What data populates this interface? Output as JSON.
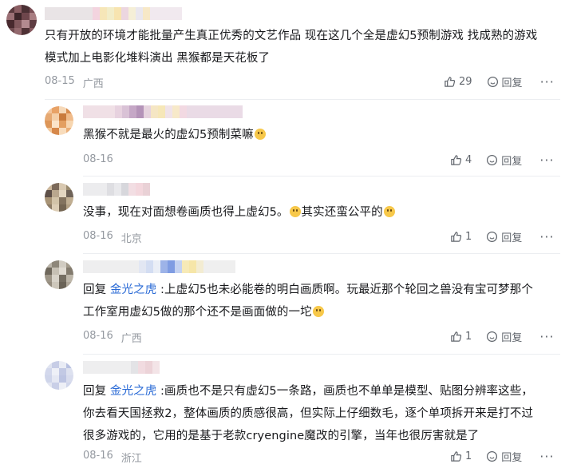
{
  "comments": [
    {
      "text_lines": [
        "只有开放的环境才能批量产生真正优秀的文艺作品 现在这几个全是虚幻5预制游戏 找成熟的游戏",
        "模式加上电影化堆料演出 黑猴都是天花板了"
      ],
      "date": "08-15",
      "location": "广西",
      "like_count": "29",
      "reply_label": "回复",
      "more_label": "···"
    },
    {
      "text_lines": [
        "黑猴不就是最火的虚幻5预制菜嘛"
      ],
      "emoji": "laugh-emoji",
      "date": "08-16",
      "location": "",
      "like_count": "4",
      "reply_label": "回复",
      "more_label": "···"
    },
    {
      "text_lines": [
        "没事，现在对面想卷画质也得上虚幻5。",
        "其实还蛮公平的"
      ],
      "date": "08-16",
      "location": "北京",
      "like_count": "1",
      "reply_label": "回复",
      "more_label": "···"
    },
    {
      "reply_prefix": "回复 ",
      "reply_target": "金光之虎",
      "text_lines": [
        " :上虚幻5也未必能卷的明白画质啊。玩最近那个轮回之兽没有宝可梦那个",
        "工作室用虚幻5做的那个还不是画面做的一坨"
      ],
      "date": "08-16",
      "location": "广西",
      "like_count": "1",
      "reply_label": "回复",
      "more_label": "···"
    },
    {
      "reply_prefix": "回复 ",
      "reply_target": "金光之虎",
      "text_lines": [
        " :画质也不是只有虚幻5一条路，画质也不单单是模型、贴图分辨率这些，",
        "你去看天国拯救2，整体画质的质感很高，但实际上仔细数毛，逐个单项拆开来是打不过",
        "很多游戏的，它用的是基于老款cryengine魔改的引擎，当年也很厉害就是了"
      ],
      "date": "08-16",
      "location": "浙江",
      "like_count": "1",
      "reply_label": "回复",
      "more_label": "···"
    }
  ],
  "colors": {
    "link": "#2b6bd6",
    "meta": "#9499a0",
    "text": "#18191c"
  },
  "icons": {
    "like": "thumbs-up-icon",
    "reply": "reply-icon",
    "more": "more-icon"
  }
}
